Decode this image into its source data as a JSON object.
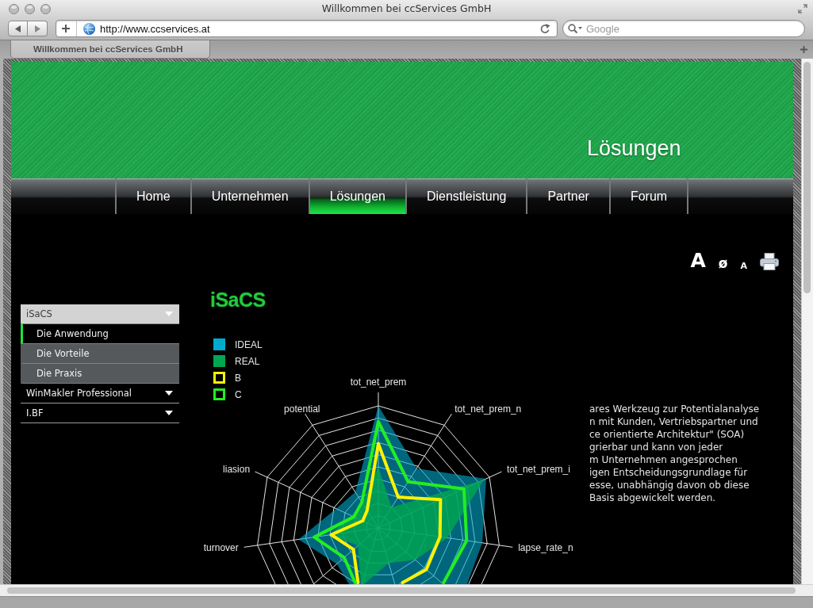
{
  "window": {
    "title": "Willkommen bei ccServices GmbH"
  },
  "toolbar": {
    "url": "http://www.ccservices.at",
    "search": {
      "placeholder": "Google"
    }
  },
  "tabs": [
    {
      "label": "Willkommen bei ccServices GmbH",
      "selected": true
    }
  ],
  "page": {
    "banner": {
      "title": "Lösungen"
    },
    "nav": [
      {
        "label": "Home",
        "selected": false
      },
      {
        "label": "Unternehmen",
        "selected": false
      },
      {
        "label": "Lösungen",
        "selected": true
      },
      {
        "label": "Dienstleistung",
        "selected": false
      },
      {
        "label": "Partner",
        "selected": false
      },
      {
        "label": "Forum",
        "selected": false
      }
    ],
    "text_size": [
      {
        "kind": "large",
        "label": "A"
      },
      {
        "kind": "reset",
        "label": "ø"
      },
      {
        "kind": "small",
        "label": "A"
      }
    ],
    "sidebar": {
      "items": [
        {
          "label": "iSaCS",
          "expanded": true,
          "children": [
            {
              "label": "Die Anwendung",
              "selected": true
            },
            {
              "label": "Die Vorteile",
              "selected": false
            },
            {
              "label": "Die Praxis",
              "selected": false
            }
          ]
        },
        {
          "label": "WinMakler Professional",
          "expanded": false
        },
        {
          "label": "I.BF",
          "expanded": false
        }
      ]
    },
    "logo": {
      "text": "iSaCS"
    },
    "chart": {
      "legend": [
        {
          "label": "IDEAL",
          "kind": "area",
          "color": "#00aacf"
        },
        {
          "label": "REAL",
          "kind": "area",
          "color": "#00a651"
        },
        {
          "label": "B",
          "kind": "line",
          "color": "#fff200"
        },
        {
          "label": "C",
          "kind": "line",
          "color": "#22ee22"
        }
      ],
      "axis_labels": [
        "tot_net_prem",
        "tot_net_prem_n",
        "tot_net_prem_i",
        "lapse_rate_n",
        "turnover",
        "liasion",
        "potential"
      ]
    },
    "text_lines": [
      "ares Werkzeug zur Potentialanalyse",
      "n mit Kunden, Vertriebspartner und",
      "ce orientierte Architektur\" (SOA)",
      "grierbar und kann von jeder",
      "m Unternehmen angesprochen",
      "igen Entscheidungsgrundlage für",
      "esse, unabhängig davon ob diese",
      "Basis abgewickelt werden."
    ]
  }
}
